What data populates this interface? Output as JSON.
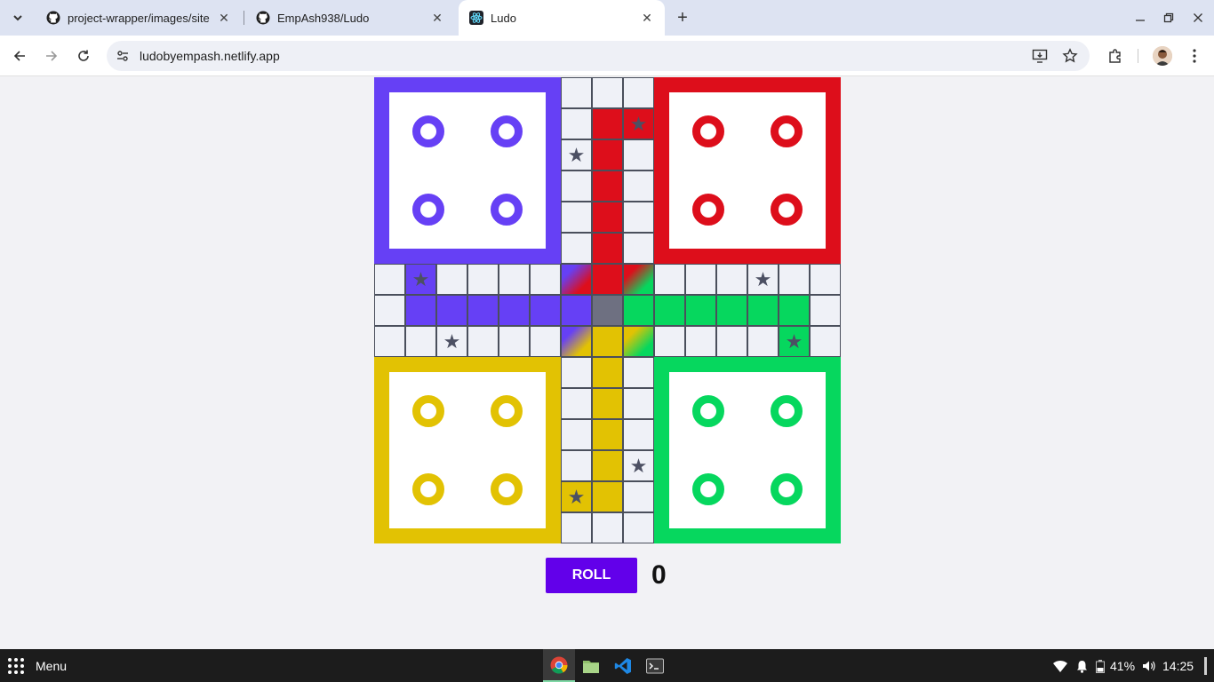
{
  "browser": {
    "tabs": [
      {
        "title": "project-wrapper/images/site",
        "icon": "github-icon",
        "active": false
      },
      {
        "title": "EmpAsh938/Ludo",
        "icon": "github-icon",
        "active": false
      },
      {
        "title": "Ludo",
        "icon": "react-icon",
        "active": true
      }
    ],
    "url": "ludobyempash.netlify.app"
  },
  "board": {
    "colors": {
      "blue": "#6640f5",
      "red": "#dd0e1b",
      "yellow": "#e2c203",
      "green": "#06d75e",
      "cell": "#eff1f7",
      "center": "#6e7081",
      "grid": "#4a4f5c"
    },
    "homes": [
      "blue",
      "red",
      "yellow",
      "green"
    ],
    "pieces_per_home": 4,
    "star_icon": "★"
  },
  "controls": {
    "roll_label": "ROLL",
    "dice_value": "0",
    "roll_color": "#6200ea"
  },
  "taskbar": {
    "menu_label": "Menu",
    "battery": "41%",
    "clock": "14:25"
  }
}
